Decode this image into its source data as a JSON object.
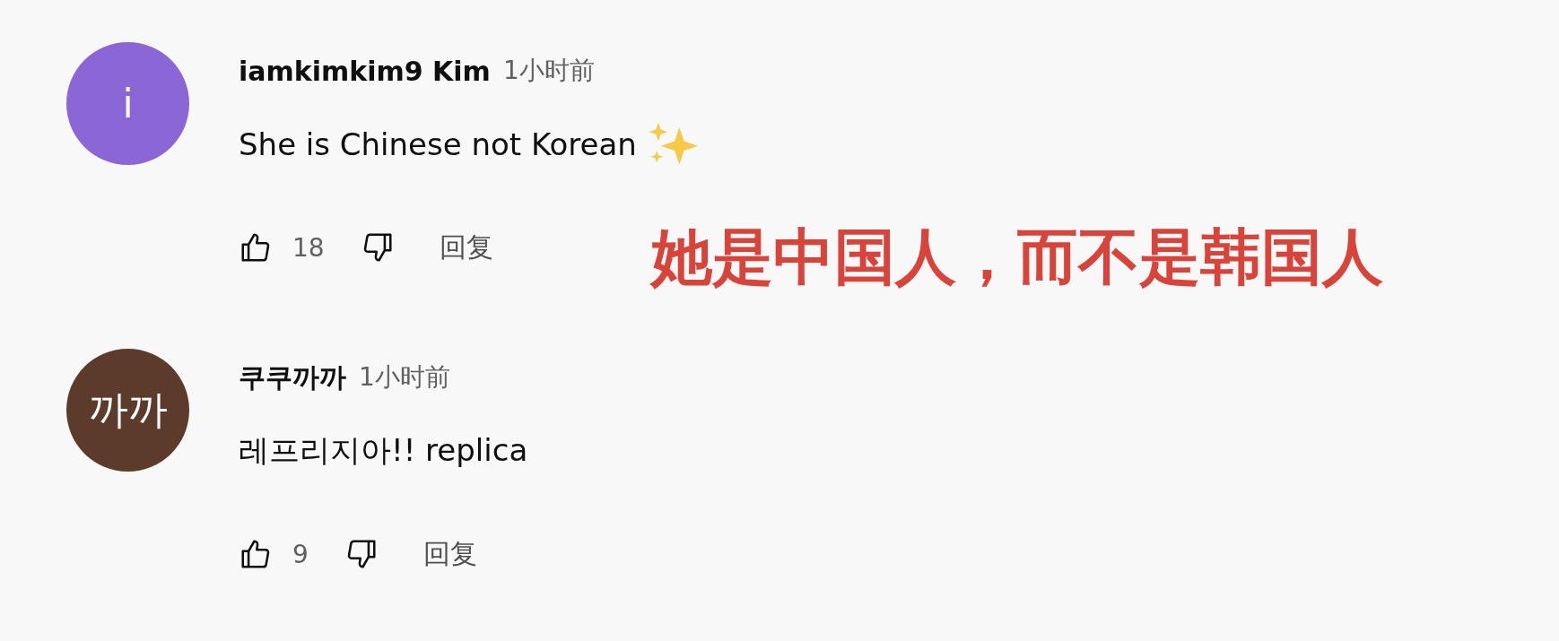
{
  "comments": [
    {
      "avatar": {
        "letter": "i",
        "color": "#8b66d6"
      },
      "author": "iamkimkim9 Kim",
      "time": "1小时前",
      "text": "She is Chinese not Korean",
      "sparkles": true,
      "likes": "18",
      "reply": "回复"
    },
    {
      "avatar": {
        "letter": "까까",
        "color": "#5c3b2a"
      },
      "author": "쿠쿠까까",
      "time": "1小时前",
      "text": "레프리지아!! replica",
      "sparkles": false,
      "likes": "9",
      "reply": "回复"
    }
  ],
  "caption": "她是中国人，而不是韩国人"
}
